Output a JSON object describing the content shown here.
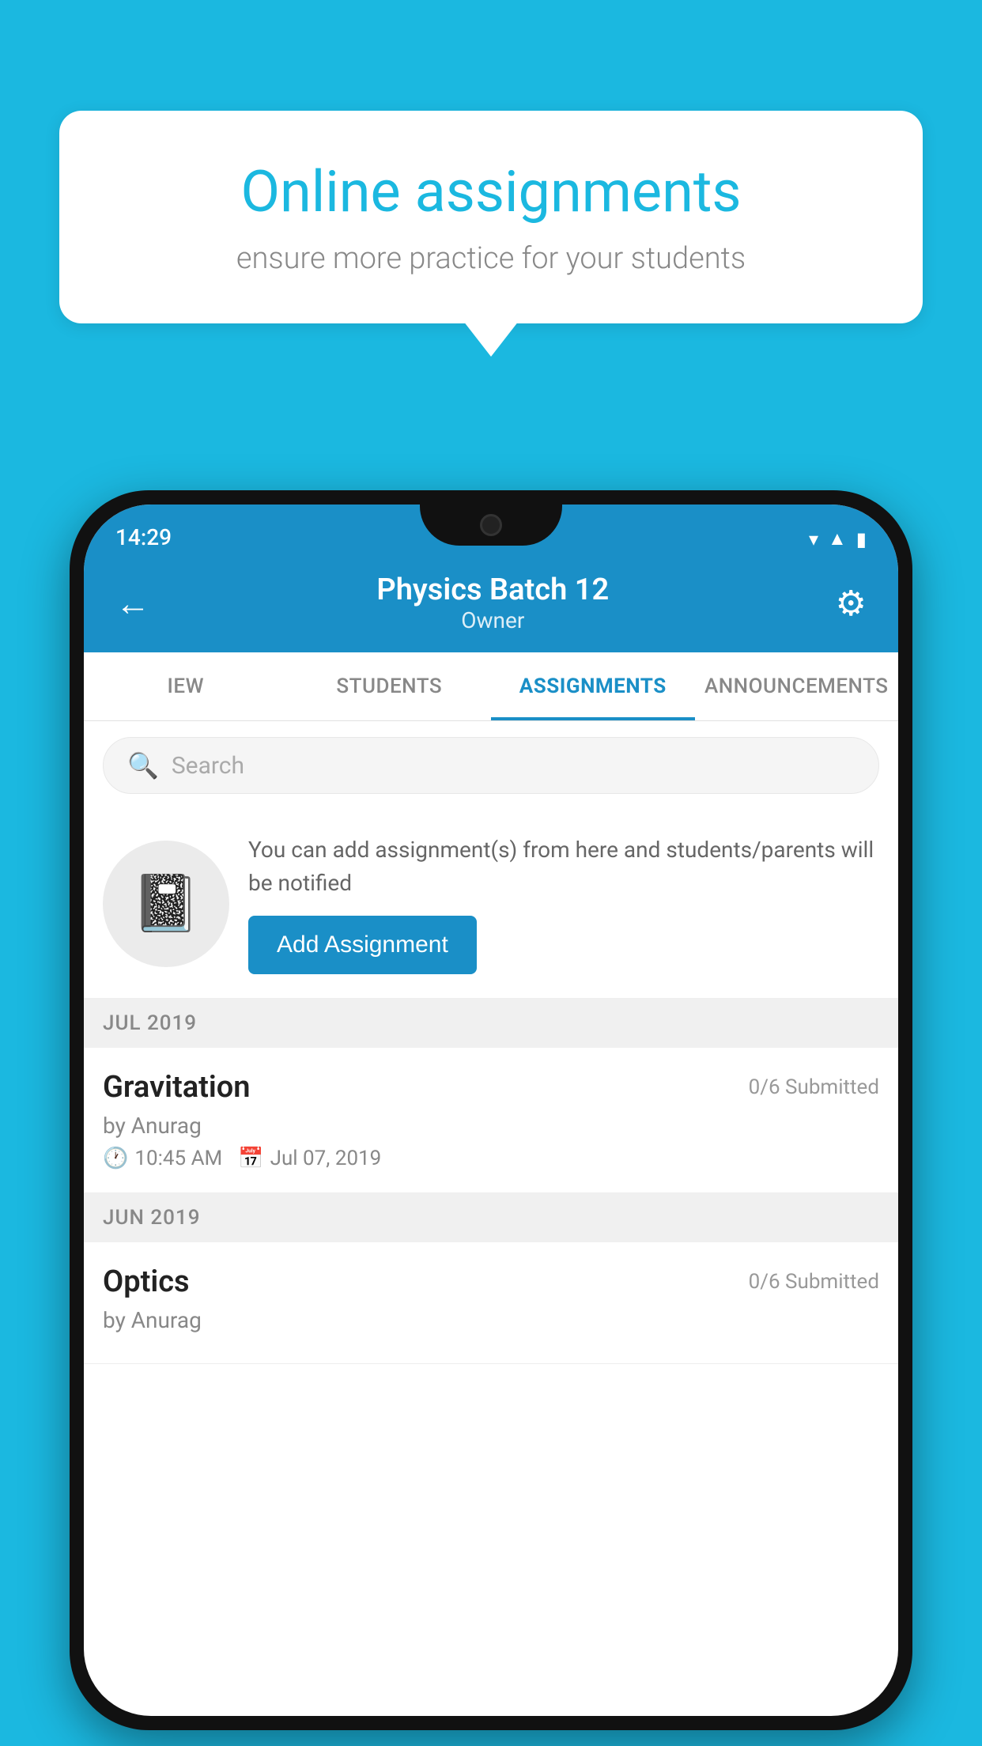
{
  "background_color": "#1BB8E0",
  "speech_bubble": {
    "title": "Online assignments",
    "subtitle": "ensure more practice for your students"
  },
  "status_bar": {
    "time": "14:29",
    "icons": [
      "wifi",
      "signal",
      "battery"
    ]
  },
  "header": {
    "title": "Physics Batch 12",
    "subtitle": "Owner",
    "back_label": "←",
    "settings_label": "⚙"
  },
  "tabs": [
    {
      "label": "IEW",
      "active": false
    },
    {
      "label": "STUDENTS",
      "active": false
    },
    {
      "label": "ASSIGNMENTS",
      "active": true
    },
    {
      "label": "ANNOUNCEMENTS",
      "active": false
    }
  ],
  "search": {
    "placeholder": "Search"
  },
  "promo": {
    "description": "You can add assignment(s) from here and students/parents will be notified",
    "button_label": "Add Assignment"
  },
  "sections": [
    {
      "month_label": "JUL 2019",
      "assignments": [
        {
          "name": "Gravitation",
          "submitted": "0/6 Submitted",
          "by": "by Anurag",
          "time": "10:45 AM",
          "date": "Jul 07, 2019"
        }
      ]
    },
    {
      "month_label": "JUN 2019",
      "assignments": [
        {
          "name": "Optics",
          "submitted": "0/6 Submitted",
          "by": "by Anurag",
          "time": "",
          "date": ""
        }
      ]
    }
  ]
}
